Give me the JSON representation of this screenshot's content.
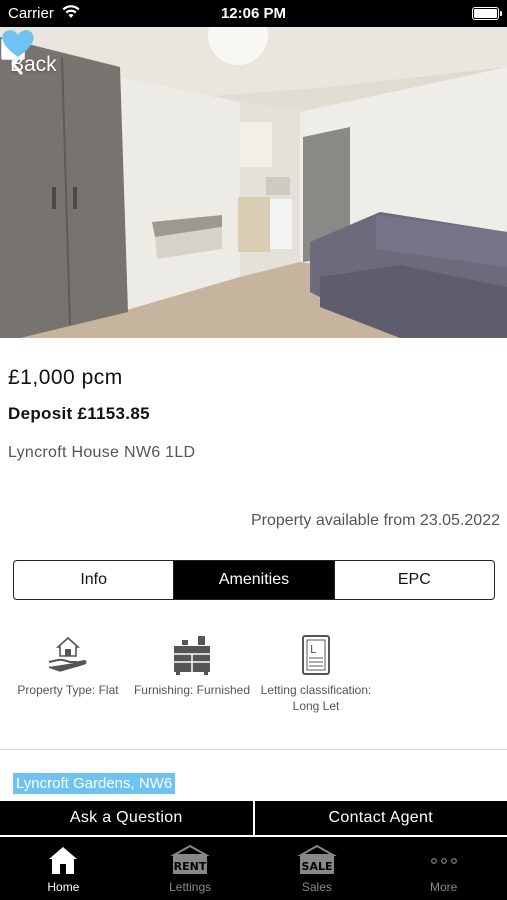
{
  "status_bar": {
    "carrier": "Carrier",
    "time": "12:06 PM"
  },
  "hero": {
    "back_label": "Back",
    "favorite_color": "#6ec3f2"
  },
  "listing": {
    "price": "£1,000 pcm",
    "deposit": "Deposit £1153.85",
    "address": "Lyncroft House NW6 1LD",
    "availability": "Property available from 23.05.2022"
  },
  "tabs": [
    {
      "label": "Info"
    },
    {
      "label": "Amenities",
      "active": true
    },
    {
      "label": "EPC"
    }
  ],
  "amenities": [
    {
      "icon": "house-hand-icon",
      "label": "Property Type: Flat"
    },
    {
      "icon": "drawers-icon",
      "label": "Furnishing: Furnished"
    },
    {
      "icon": "document-icon",
      "label": "Letting classification: Long Let"
    }
  ],
  "location": {
    "label": "Lyncroft Gardens, NW6",
    "highlight_color": "#6ec3f2"
  },
  "actions": {
    "ask_question": "Ask a Question",
    "contact_agent": "Contact Agent"
  },
  "tab_bar": {
    "items": [
      {
        "icon": "home-icon",
        "label": "Home",
        "active": true
      },
      {
        "icon": "rent-sign-icon",
        "label": "Lettings",
        "sign_text": "RENT"
      },
      {
        "icon": "sale-sign-icon",
        "label": "Sales",
        "sign_text": "SALE"
      },
      {
        "icon": "more-icon",
        "label": "More"
      }
    ]
  }
}
